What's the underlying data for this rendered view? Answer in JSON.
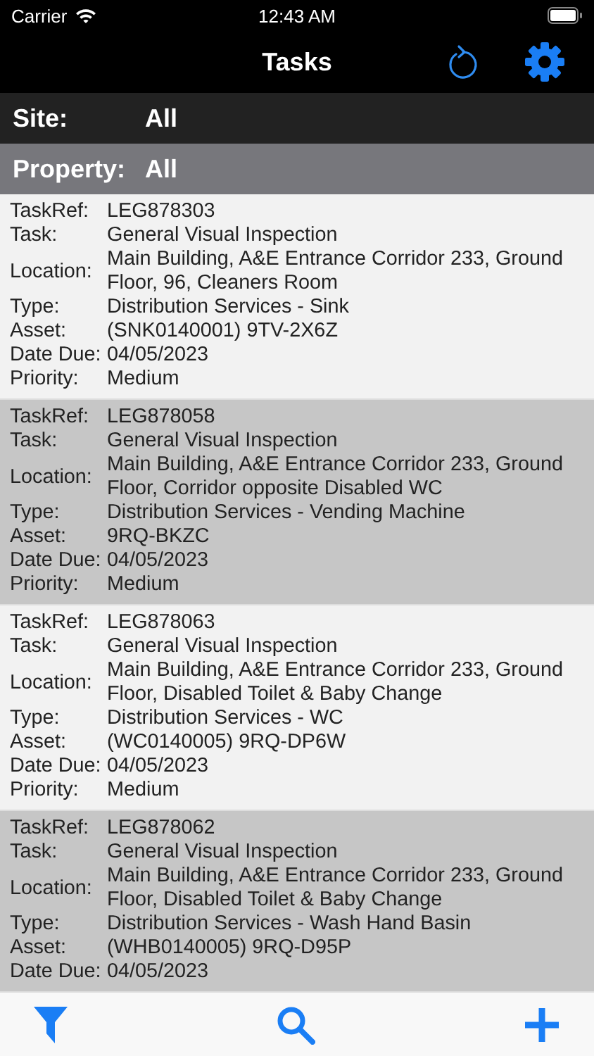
{
  "status_bar": {
    "carrier": "Carrier",
    "time": "12:43 AM"
  },
  "nav": {
    "title": "Tasks"
  },
  "filters": [
    {
      "label": "Site:",
      "value": "All"
    },
    {
      "label": "Property:",
      "value": "All"
    }
  ],
  "tasks": [
    {
      "fields": [
        {
          "label": "TaskRef:",
          "value": "LEG878303"
        },
        {
          "label": "Task:",
          "value": "General Visual Inspection"
        },
        {
          "label": "Location:",
          "value": "Main Building, A&E Entrance Corridor 233, Ground Floor, 96, Cleaners Room"
        },
        {
          "label": "Type:",
          "value": "Distribution Services - Sink"
        },
        {
          "label": "Asset:",
          "value": "(SNK0140001) 9TV-2X6Z"
        },
        {
          "label": "Date Due:",
          "value": "04/05/2023"
        },
        {
          "label": "Priority:",
          "value": "Medium"
        }
      ]
    },
    {
      "fields": [
        {
          "label": "TaskRef:",
          "value": "LEG878058"
        },
        {
          "label": "Task:",
          "value": "General Visual Inspection"
        },
        {
          "label": "Location:",
          "value": "Main Building, A&E Entrance Corridor 233, Ground Floor, Corridor opposite Disabled WC"
        },
        {
          "label": "Type:",
          "value": "Distribution Services - Vending Machine"
        },
        {
          "label": "Asset:",
          "value": "9RQ-BKZC"
        },
        {
          "label": "Date Due:",
          "value": "04/05/2023"
        },
        {
          "label": "Priority:",
          "value": "Medium"
        }
      ]
    },
    {
      "fields": [
        {
          "label": "TaskRef:",
          "value": "LEG878063"
        },
        {
          "label": "Task:",
          "value": "General Visual Inspection"
        },
        {
          "label": "Location:",
          "value": "Main Building, A&E Entrance Corridor 233, Ground Floor, Disabled Toilet & Baby Change"
        },
        {
          "label": "Type:",
          "value": "Distribution Services - WC"
        },
        {
          "label": "Asset:",
          "value": "(WC0140005) 9RQ-DP6W"
        },
        {
          "label": "Date Due:",
          "value": "04/05/2023"
        },
        {
          "label": "Priority:",
          "value": "Medium"
        }
      ]
    },
    {
      "fields": [
        {
          "label": "TaskRef:",
          "value": "LEG878062"
        },
        {
          "label": "Task:",
          "value": "General Visual Inspection"
        },
        {
          "label": "Location:",
          "value": "Main Building, A&E Entrance Corridor 233, Ground Floor, Disabled Toilet & Baby Change"
        },
        {
          "label": "Type:",
          "value": "Distribution Services - Wash Hand Basin"
        },
        {
          "label": "Asset:",
          "value": "(WHB0140005) 9RQ-D95P"
        },
        {
          "label": "Date Due:",
          "value": "04/05/2023"
        }
      ]
    }
  ]
}
